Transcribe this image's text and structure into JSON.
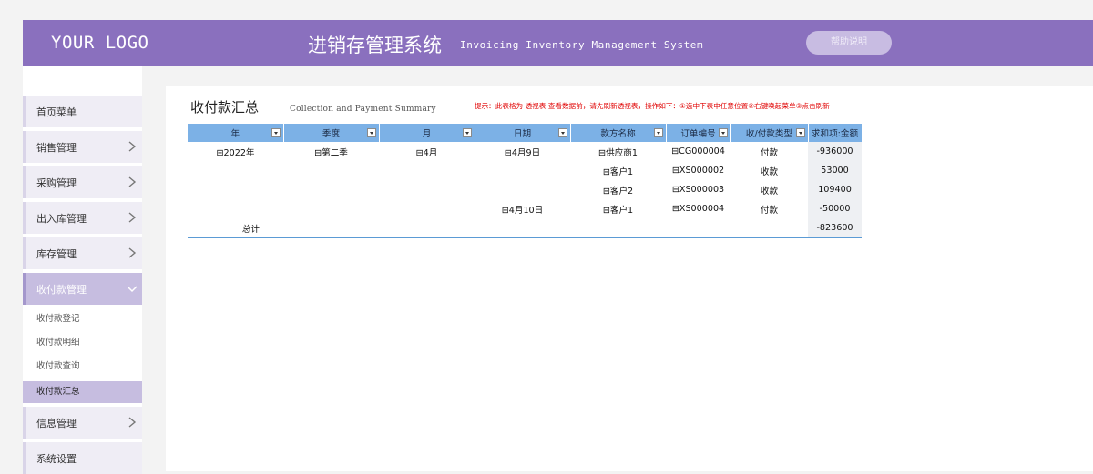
{
  "header": {
    "logo": "YOUR LOGO",
    "title": "进销存管理系统",
    "subtitle": "Invoicing Inventory Management System",
    "help_label": "帮助说明"
  },
  "sidebar": {
    "items": [
      {
        "label": "首页菜单",
        "chevron": "none"
      },
      {
        "label": "销售管理",
        "chevron": "right"
      },
      {
        "label": "采购管理",
        "chevron": "right"
      },
      {
        "label": "出入库管理",
        "chevron": "right"
      },
      {
        "label": "库存管理",
        "chevron": "right"
      },
      {
        "label": "收付款管理",
        "chevron": "down",
        "active": true
      },
      {
        "label": "信息管理",
        "chevron": "right"
      },
      {
        "label": "系统设置",
        "chevron": "none"
      }
    ],
    "subitems": [
      {
        "label": "收付款登记"
      },
      {
        "label": "收付款明细"
      },
      {
        "label": "收付款查询"
      },
      {
        "label": "收付款汇总",
        "active": true
      }
    ]
  },
  "page": {
    "title": "收付款汇总",
    "subtitle": "Collection and Payment Summary",
    "hint": "提示：此表格为 透视表 查看数据前，请先刷新透视表，操作如下：①选中下表中任意位置②右键唤起菜单③点击刷新"
  },
  "table": {
    "columns": [
      "年",
      "季度",
      "月",
      "日期",
      "款方名称",
      "订单编号",
      "收/付款类型",
      "求和项:金额"
    ],
    "rows": [
      [
        "⊟2022年",
        "⊟第二季",
        "⊟4月",
        "⊟4月9日",
        "⊟供应商1",
        "⊟CG000004",
        "付款",
        "-936000"
      ],
      [
        "",
        "",
        "",
        "",
        "⊟客户1",
        "⊟XS000002",
        "收款",
        "53000"
      ],
      [
        "",
        "",
        "",
        "",
        "⊟客户2",
        "⊟XS000003",
        "收款",
        "109400"
      ],
      [
        "",
        "",
        "",
        "⊟4月10日",
        "⊟客户1",
        "⊟XS000004",
        "付款",
        "-50000"
      ]
    ],
    "total": {
      "label": "总计",
      "value": "-823600"
    }
  }
}
